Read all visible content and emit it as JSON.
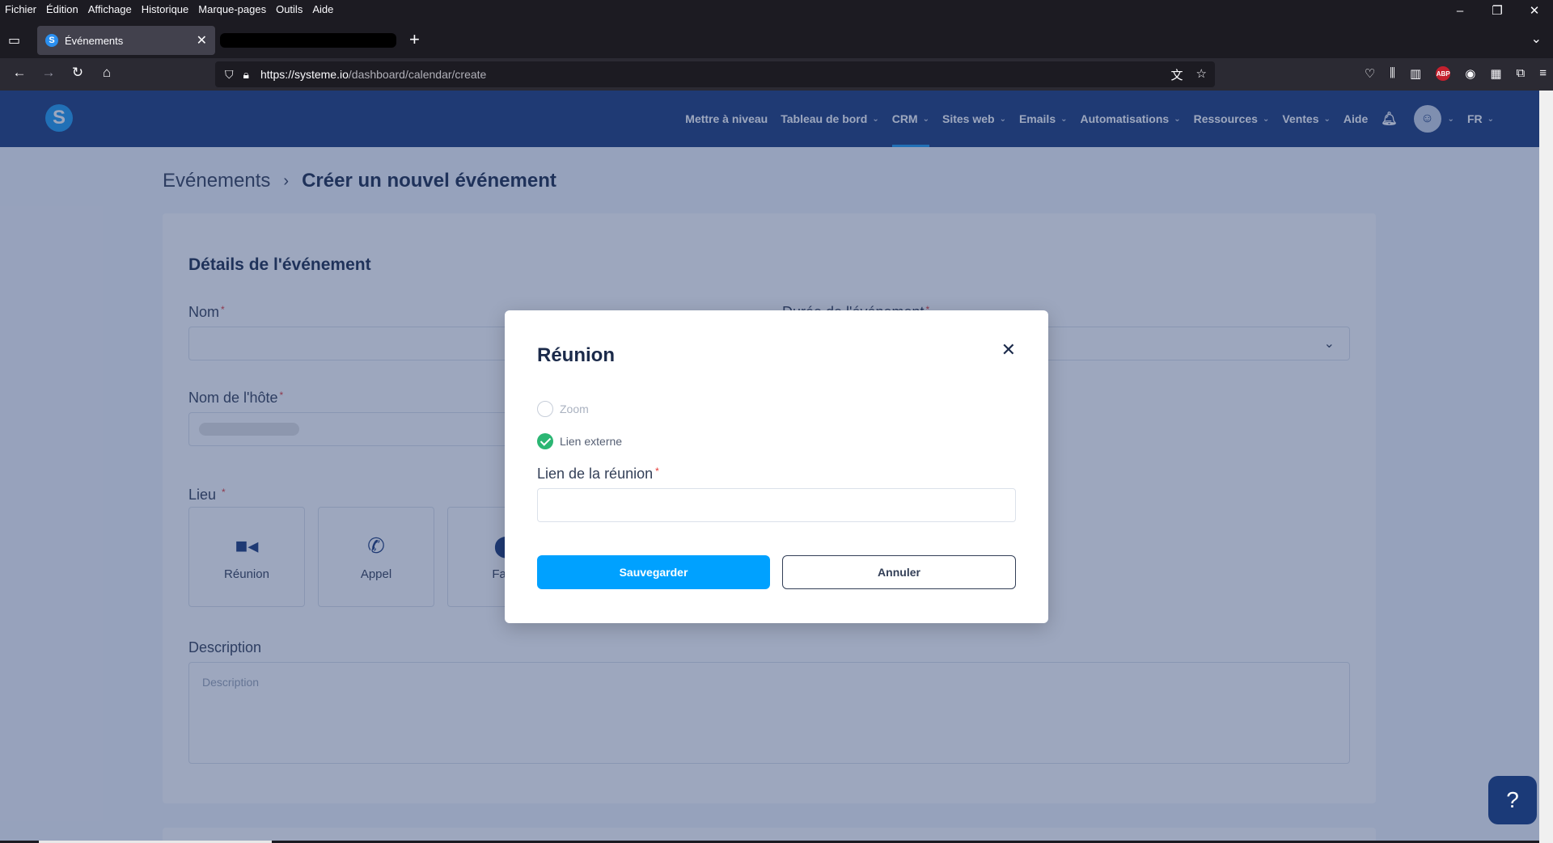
{
  "browser": {
    "menu": [
      "Fichier",
      "Édition",
      "Affichage",
      "Historique",
      "Marque-pages",
      "Outils",
      "Aide"
    ],
    "tab": {
      "title": "Événements",
      "favicon_letter": "S"
    },
    "url_host": "https://systeme.io",
    "url_path": "/dashboard/calendar/create",
    "icons": {
      "tab_list": "tab-list-icon",
      "back": "back-arrow-icon",
      "forward": "forward-arrow-icon",
      "reload": "reload-icon",
      "home": "home-icon",
      "shield": "shield-icon",
      "lock": "lock-icon",
      "translate": "translate-icon",
      "bookmark": "star-icon",
      "pocket": "pocket-icon",
      "library": "library-icon",
      "sidebar": "sidebar-icon",
      "account": "account-icon",
      "extensions": "extensions-icon",
      "menu": "hamburger-icon"
    },
    "abp_label": "ABP"
  },
  "app": {
    "logo_letter": "S",
    "nav": [
      {
        "label": "Mettre à niveau",
        "dropdown": false
      },
      {
        "label": "Tableau de bord",
        "dropdown": true
      },
      {
        "label": "CRM",
        "dropdown": true,
        "active": true
      },
      {
        "label": "Sites web",
        "dropdown": true
      },
      {
        "label": "Emails",
        "dropdown": true
      },
      {
        "label": "Automatisations",
        "dropdown": true
      },
      {
        "label": "Ressources",
        "dropdown": true
      },
      {
        "label": "Ventes",
        "dropdown": true
      },
      {
        "label": "Aide",
        "dropdown": false
      }
    ],
    "language": "FR",
    "accent_color": "#1e9bf0",
    "header_color": "#1b3a78"
  },
  "breadcrumb": {
    "parent": "Evénements",
    "current": "Créer un nouvel événement"
  },
  "form": {
    "section_title": "Détails de l'événement",
    "name_label": "Nom",
    "duration_label": "Durée de l'événement",
    "host_label": "Nom de l'hôte",
    "location_label": "Lieu",
    "locations": [
      "Réunion",
      "Appel",
      "Face"
    ],
    "description_label": "Description",
    "description_placeholder": "Description"
  },
  "modal": {
    "title": "Réunion",
    "options": [
      {
        "label": "Zoom",
        "checked": false,
        "disabled": true
      },
      {
        "label": "Lien externe",
        "checked": true,
        "disabled": false
      }
    ],
    "link_label": "Lien de la réunion",
    "link_value": "",
    "save_label": "Sauvegarder",
    "cancel_label": "Annuler",
    "save_color": "#00a1ff",
    "check_color": "#2bb673"
  },
  "help_label": "?"
}
